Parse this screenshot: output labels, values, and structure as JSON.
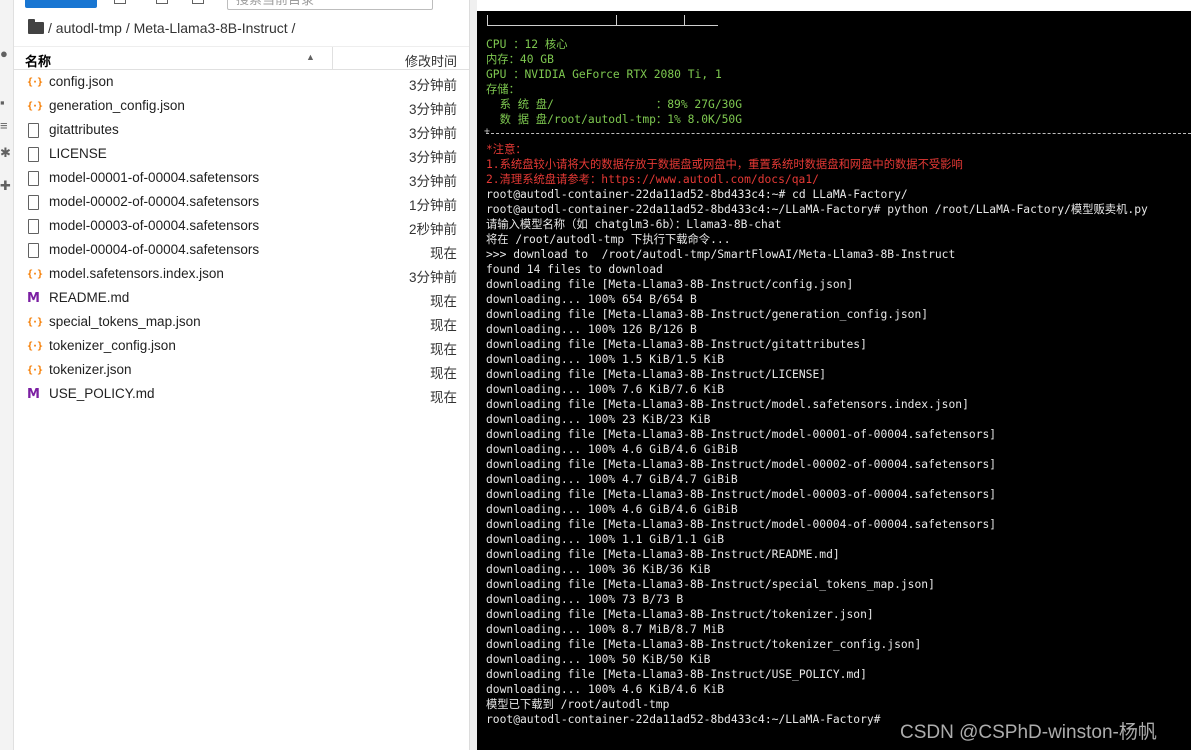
{
  "search": {
    "placeholder": "搜索当前目录"
  },
  "breadcrumb": {
    "path": "/ autodl-tmp / Meta-Llama3-8B-Instruct /"
  },
  "list_header": {
    "name": "名称",
    "modified": "修改时间"
  },
  "files": [
    {
      "name": "config.json",
      "modified": "3分钟前",
      "icon": "json-icon"
    },
    {
      "name": "generation_config.json",
      "modified": "3分钟前",
      "icon": "json-icon"
    },
    {
      "name": "gitattributes",
      "modified": "3分钟前",
      "icon": "file-icon"
    },
    {
      "name": "LICENSE",
      "modified": "3分钟前",
      "icon": "file-icon"
    },
    {
      "name": "model-00001-of-00004.safetensors",
      "modified": "3分钟前",
      "icon": "file-icon"
    },
    {
      "name": "model-00002-of-00004.safetensors",
      "modified": "1分钟前",
      "icon": "file-icon"
    },
    {
      "name": "model-00003-of-00004.safetensors",
      "modified": "2秒钟前",
      "icon": "file-icon"
    },
    {
      "name": "model-00004-of-00004.safetensors",
      "modified": "现在",
      "icon": "file-icon"
    },
    {
      "name": "model.safetensors.index.json",
      "modified": "3分钟前",
      "icon": "json-icon"
    },
    {
      "name": "README.md",
      "modified": "现在",
      "icon": "markdown-icon"
    },
    {
      "name": "special_tokens_map.json",
      "modified": "现在",
      "icon": "json-icon"
    },
    {
      "name": "tokenizer_config.json",
      "modified": "现在",
      "icon": "json-icon"
    },
    {
      "name": "tokenizer.json",
      "modified": "现在",
      "icon": "json-icon"
    },
    {
      "name": "USE_POLICY.md",
      "modified": "现在",
      "icon": "markdown-icon"
    }
  ],
  "terminal": {
    "lines": [
      {
        "text": "CPU ：12 核心",
        "color": "green-label"
      },
      {
        "text": "内存：40 GB",
        "color": "green-label"
      },
      {
        "text": "GPU ：NVIDIA GeForce RTX 2080 Ti, 1",
        "color": "green-label"
      },
      {
        "text": "存储：",
        "color": "green-label"
      },
      {
        "text": "  系 统 盘/               ：89% 27G/30G",
        "color": "green-label"
      },
      {
        "text": "  数 据 盘/root/autodl-tmp：1% 8.0K/50G",
        "color": "green-label"
      },
      {
        "text": "*注意：",
        "color": "red"
      },
      {
        "text": "1.系统盘较小请将大的数据存放于数据盘或网盘中，重置系统时数据盘和网盘中的数据不受影响",
        "color": "red"
      },
      {
        "text": "2.清理系统盘请参考：https://www.autodl.com/docs/qa1/",
        "color": "red"
      },
      {
        "text": "root@autodl-container-22da11ad52-8bd433c4:~# cd LLaMA-Factory/",
        "color": "white"
      },
      {
        "text": "root@autodl-container-22da11ad52-8bd433c4:~/LLaMA-Factory# python /root/LLaMA-Factory/模型贩卖机.py",
        "color": "white"
      },
      {
        "text": "请输入模型名称（如 chatglm3-6b）：Llama3-8B-chat",
        "color": "white"
      },
      {
        "text": "将在 /root/autodl-tmp 下执行下载命令...",
        "color": "white"
      },
      {
        "text": ">>> download to  /root/autodl-tmp/SmartFlowAI/Meta-Llama3-8B-Instruct",
        "color": "white"
      },
      {
        "text": "found 14 files to download",
        "color": "white"
      },
      {
        "text": "downloading file [Meta-Llama3-8B-Instruct/config.json]",
        "color": "white"
      },
      {
        "text": "downloading... 100% 654 B/654 B",
        "color": "white"
      },
      {
        "text": "downloading file [Meta-Llama3-8B-Instruct/generation_config.json]",
        "color": "white"
      },
      {
        "text": "downloading... 100% 126 B/126 B",
        "color": "white"
      },
      {
        "text": "downloading file [Meta-Llama3-8B-Instruct/gitattributes]",
        "color": "white"
      },
      {
        "text": "downloading... 100% 1.5 KiB/1.5 KiB",
        "color": "white"
      },
      {
        "text": "downloading file [Meta-Llama3-8B-Instruct/LICENSE]",
        "color": "white"
      },
      {
        "text": "downloading... 100% 7.6 KiB/7.6 KiB",
        "color": "white"
      },
      {
        "text": "downloading file [Meta-Llama3-8B-Instruct/model.safetensors.index.json]",
        "color": "white"
      },
      {
        "text": "downloading... 100% 23 KiB/23 KiB",
        "color": "white"
      },
      {
        "text": "downloading file [Meta-Llama3-8B-Instruct/model-00001-of-00004.safetensors]",
        "color": "white"
      },
      {
        "text": "downloading... 100% 4.6 GiB/4.6 GiBiB",
        "color": "white"
      },
      {
        "text": "downloading file [Meta-Llama3-8B-Instruct/model-00002-of-00004.safetensors]",
        "color": "white"
      },
      {
        "text": "downloading... 100% 4.7 GiB/4.7 GiBiB",
        "color": "white"
      },
      {
        "text": "downloading file [Meta-Llama3-8B-Instruct/model-00003-of-00004.safetensors]",
        "color": "white"
      },
      {
        "text": "downloading... 100% 4.6 GiB/4.6 GiBiB",
        "color": "white"
      },
      {
        "text": "downloading file [Meta-Llama3-8B-Instruct/model-00004-of-00004.safetensors]",
        "color": "white"
      },
      {
        "text": "downloading... 100% 1.1 GiB/1.1 GiB",
        "color": "white"
      },
      {
        "text": "downloading file [Meta-Llama3-8B-Instruct/README.md]",
        "color": "white"
      },
      {
        "text": "downloading... 100% 36 KiB/36 KiB",
        "color": "white"
      },
      {
        "text": "downloading file [Meta-Llama3-8B-Instruct/special_tokens_map.json]",
        "color": "white"
      },
      {
        "text": "downloading... 100% 73 B/73 B",
        "color": "white"
      },
      {
        "text": "downloading file [Meta-Llama3-8B-Instruct/tokenizer.json]",
        "color": "white"
      },
      {
        "text": "downloading... 100% 8.7 MiB/8.7 MiB",
        "color": "white"
      },
      {
        "text": "downloading file [Meta-Llama3-8B-Instruct/tokenizer_config.json]",
        "color": "white"
      },
      {
        "text": "downloading... 100% 50 KiB/50 KiB",
        "color": "white"
      },
      {
        "text": "downloading file [Meta-Llama3-8B-Instruct/USE_POLICY.md]",
        "color": "white"
      },
      {
        "text": "downloading... 100% 4.6 KiB/4.6 KiB",
        "color": "white"
      },
      {
        "text": "模型已下载到 /root/autodl-tmp",
        "color": "white"
      },
      {
        "text": "root@autodl-container-22da11ad52-8bd433c4:~/LLaMA-Factory# ",
        "color": "white"
      }
    ]
  },
  "watermark": "CSDN @CSPhD-winston-杨帆",
  "colors": {
    "terminal_bg": "#000000",
    "green_label": "#7ec850",
    "red": "#e53935",
    "accent": "#1976d2"
  }
}
